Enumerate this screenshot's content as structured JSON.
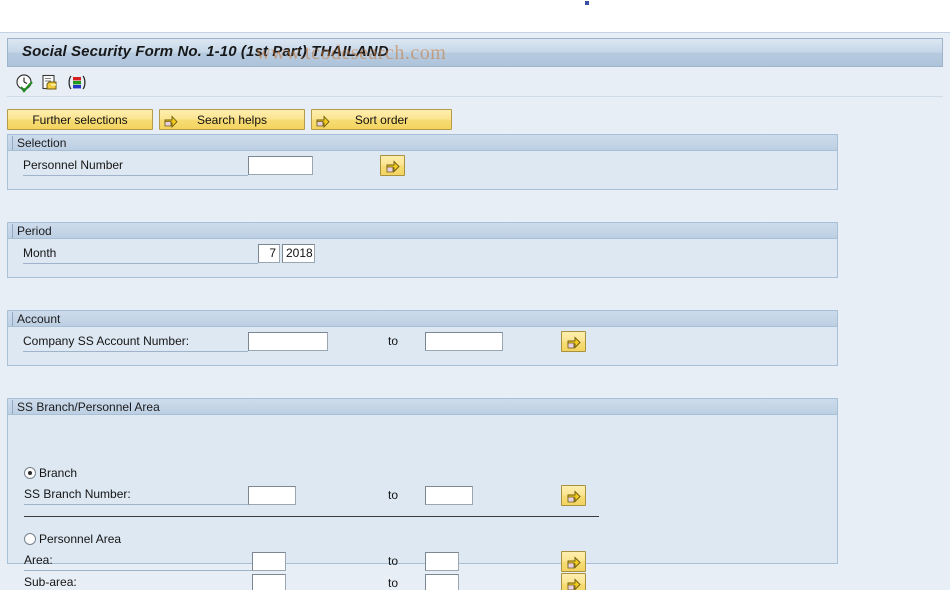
{
  "window": {
    "title": "Social Security Form No. 1-10 (1st Part) THAILAND",
    "watermark": "www.tcodesearch.com"
  },
  "toolbar": {
    "items": [
      {
        "name": "execute-icon",
        "tooltip": "Execute"
      },
      {
        "name": "execute-background-icon",
        "tooltip": "Execute in background"
      },
      {
        "name": "variants-icon",
        "tooltip": "Get variant"
      }
    ]
  },
  "buttons": {
    "further_selections": "Further selections",
    "search_helps": "Search helps",
    "sort_order": "Sort order"
  },
  "sections": {
    "selection": {
      "header": "Selection",
      "personnel_number_label": "Personnel Number",
      "personnel_number_value": "",
      "multi_select_icon": "multiple-selection-arrow-icon"
    },
    "period": {
      "header": "Period",
      "month_label": "Month",
      "month_value": "7",
      "year_value": "2018"
    },
    "account": {
      "header": "Account",
      "company_ss_account_label": "Company SS Account Number:",
      "company_ss_account_from": "",
      "to_label": "to",
      "company_ss_account_to": "",
      "multi_select_icon": "multiple-selection-arrow-icon"
    },
    "branch_area": {
      "header": "SS Branch/Personnel Area",
      "branch_radio_label": "Branch",
      "branch_radio_selected": true,
      "ss_branch_number_label": "SS Branch Number:",
      "ss_branch_number_from": "",
      "ss_branch_to_label": "to",
      "ss_branch_number_to": "",
      "personnel_area_radio_label": "Personnel Area",
      "personnel_area_radio_selected": false,
      "area_label": "Area:",
      "area_from": "",
      "area_to_label": "to",
      "area_to": "",
      "subarea_label": "Sub-area:",
      "subarea_from": "",
      "subarea_to_label": "to",
      "subarea_to": ""
    }
  },
  "colors": {
    "title_bar": "#c6d7e8",
    "panel_bg": "#dde8f2",
    "window_bg": "#e8eef5",
    "button_yellow": "#f7dc76",
    "watermark": "#c47634"
  }
}
